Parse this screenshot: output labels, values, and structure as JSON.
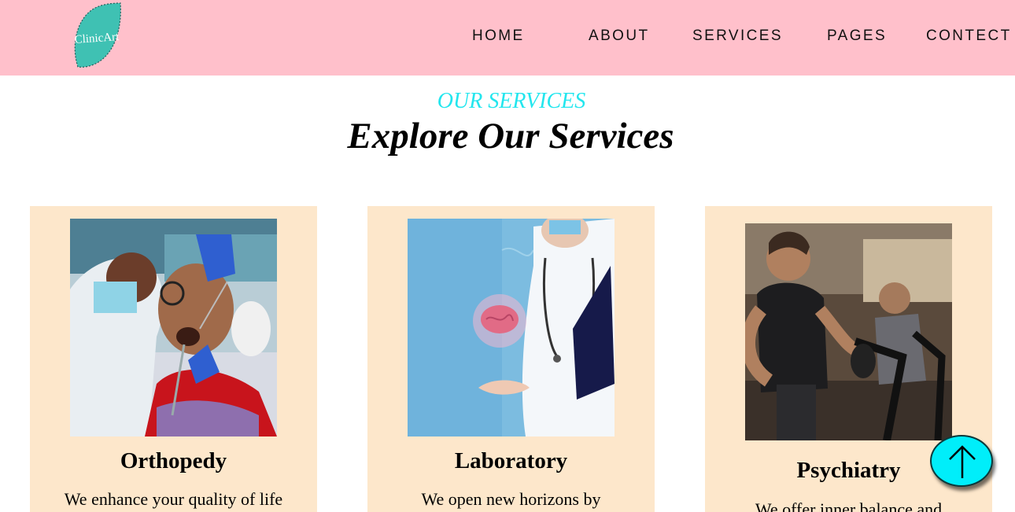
{
  "brand": {
    "logo_text": "ClinicArt",
    "logo_color": "#3fc1b3"
  },
  "nav": {
    "items": [
      {
        "label": "HOME"
      },
      {
        "label": "ABOUT"
      },
      {
        "label": "SERVICES"
      },
      {
        "label": "PAGES"
      },
      {
        "label": "CONTECT"
      }
    ]
  },
  "section": {
    "eyebrow": "OUR SERVICES",
    "heading": "Explore Our Services"
  },
  "cards": [
    {
      "title": "Orthopedy",
      "text": "We enhance your quality of life",
      "image": "dentist-examining-patient"
    },
    {
      "title": "Laboratory",
      "text": "We open new horizons by",
      "image": "doctor-holding-brain"
    },
    {
      "title": "Psychiatry",
      "text": "We offer inner balance and",
      "image": "people-exercising-on-bikes"
    }
  ],
  "colors": {
    "navbar": "#ffc0cb",
    "accent": "#22e6ee",
    "card_background": "#fde7cb",
    "back_to_top": "#00eefa"
  },
  "back_to_top": {
    "icon": "arrow-up-icon"
  }
}
